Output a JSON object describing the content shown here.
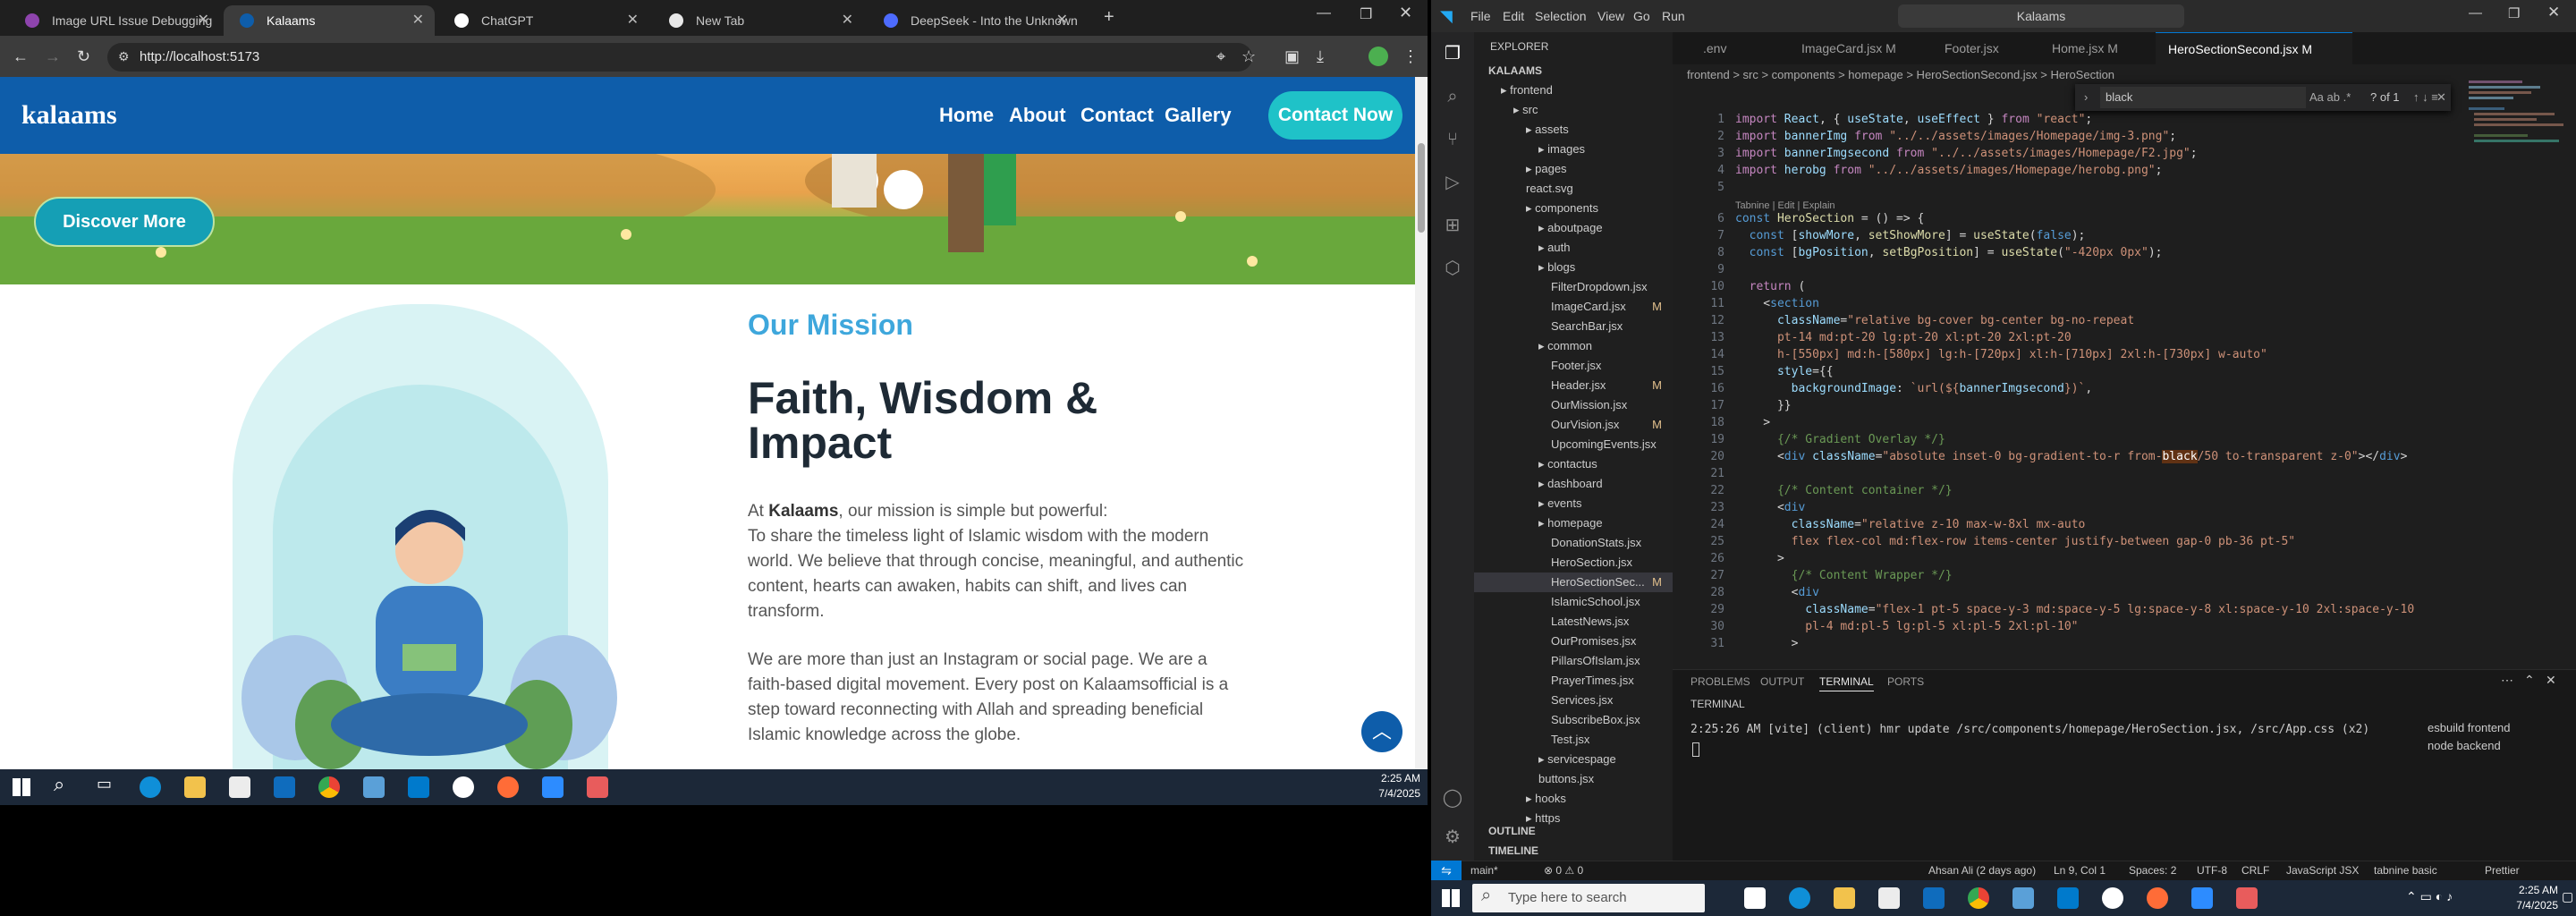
{
  "chrome": {
    "tabs": [
      {
        "label": "Image URL Issue Debugging",
        "fav": "#8e44ad"
      },
      {
        "label": "Kalaams",
        "fav": "#0e5daa"
      },
      {
        "label": "ChatGPT",
        "fav": "#ffffff"
      },
      {
        "label": "New Tab",
        "fav": "#e8e8e8"
      },
      {
        "label": "DeepSeek - Into the Unknown",
        "fav": "#4d6bfe"
      }
    ],
    "url": "http://localhost:5173"
  },
  "site": {
    "logo": "kalaams",
    "nav": [
      "Home",
      "About",
      "Contact",
      "Gallery"
    ],
    "contact_btn": "Contact Now",
    "discover_btn": "Discover More",
    "mission_label": "Our Mission",
    "mission_title": "Faith, Wisdom & Impact",
    "p1_prefix": "At ",
    "p1_brand": "Kalaams",
    "p1_suffix": ", our mission is simple but powerful:",
    "p2": "To share the timeless light of Islamic wisdom with the modern world. We believe that through concise, meaningful, and authentic content, hearts can awaken, habits can shift, and lives can transform.",
    "p3": "We are more than just an Instagram or social page. We are a faith-based digital movement. Every post on Kalaamsofficial is a step toward reconnecting with Allah and spreading beneficial Islamic knowledge across the globe."
  },
  "taskbar_left": {
    "time": "2:25 AM",
    "date": "7/4/2025"
  },
  "vscode": {
    "menu": [
      "File",
      "Edit",
      "Selection",
      "View",
      "Go",
      "Run"
    ],
    "search": "Kalaams",
    "explorer_title": "EXPLORER",
    "tree": [
      {
        "label": "KALAAMS",
        "indent": 0,
        "bold": true
      },
      {
        "label": "frontend",
        "indent": 1,
        "folder": true
      },
      {
        "label": "src",
        "indent": 2,
        "folder": true
      },
      {
        "label": "assets",
        "indent": 3,
        "folder": true
      },
      {
        "label": "images",
        "indent": 4,
        "folder": true
      },
      {
        "label": "pages",
        "indent": 3,
        "folder": true
      },
      {
        "label": "react.svg",
        "indent": 3
      },
      {
        "label": "components",
        "indent": 3,
        "folder": true
      },
      {
        "label": "aboutpage",
        "indent": 4,
        "folder": true
      },
      {
        "label": "auth",
        "indent": 4,
        "folder": true
      },
      {
        "label": "blogs",
        "indent": 4,
        "folder": true
      },
      {
        "label": "FilterDropdown.jsx",
        "indent": 5
      },
      {
        "label": "ImageCard.jsx",
        "indent": 5,
        "badge": "M"
      },
      {
        "label": "SearchBar.jsx",
        "indent": 5
      },
      {
        "label": "common",
        "indent": 4,
        "folder": true
      },
      {
        "label": "Footer.jsx",
        "indent": 5
      },
      {
        "label": "Header.jsx",
        "indent": 5,
        "badge": "M"
      },
      {
        "label": "OurMission.jsx",
        "indent": 5
      },
      {
        "label": "OurVision.jsx",
        "indent": 5,
        "badge": "M"
      },
      {
        "label": "UpcomingEvents.jsx",
        "indent": 5
      },
      {
        "label": "contactus",
        "indent": 4,
        "folder": true
      },
      {
        "label": "dashboard",
        "indent": 4,
        "folder": true
      },
      {
        "label": "events",
        "indent": 4,
        "folder": true
      },
      {
        "label": "homepage",
        "indent": 4,
        "folder": true
      },
      {
        "label": "DonationStats.jsx",
        "indent": 5
      },
      {
        "label": "HeroSection.jsx",
        "indent": 5
      },
      {
        "label": "HeroSectionSec...",
        "indent": 5,
        "badge": "M",
        "selected": true
      },
      {
        "label": "IslamicSchool.jsx",
        "indent": 5
      },
      {
        "label": "LatestNews.jsx",
        "indent": 5
      },
      {
        "label": "OurPromises.jsx",
        "indent": 5
      },
      {
        "label": "PillarsOfIslam.jsx",
        "indent": 5
      },
      {
        "label": "PrayerTimes.jsx",
        "indent": 5
      },
      {
        "label": "Services.jsx",
        "indent": 5
      },
      {
        "label": "SubscribeBox.jsx",
        "indent": 5
      },
      {
        "label": "Test.jsx",
        "indent": 5
      },
      {
        "label": "servicespage",
        "indent": 4,
        "folder": true
      },
      {
        "label": "buttons.jsx",
        "indent": 4
      },
      {
        "label": "hooks",
        "indent": 3,
        "folder": true
      },
      {
        "label": "https",
        "indent": 3,
        "folder": true
      }
    ],
    "outline": "OUTLINE",
    "timeline": "TIMELINE",
    "tabs": [
      {
        "label": ".env",
        "active": false
      },
      {
        "label": "ImageCard.jsx M",
        "active": false
      },
      {
        "label": "Footer.jsx",
        "active": false
      },
      {
        "label": "Home.jsx M",
        "active": false
      },
      {
        "label": "HeroSectionSecond.jsx M",
        "active": true
      }
    ],
    "breadcrumb": "frontend > src > components > homepage > HeroSectionSecond.jsx > HeroSection",
    "find_value": "black",
    "find_count": "? of 1",
    "codelens": "Tabnine | Edit | Explain",
    "panel_tabs": [
      "PROBLEMS",
      "OUTPUT",
      "TERMINAL",
      "PORTS"
    ],
    "terminal_label": "TERMINAL",
    "terminal_line": "2:25:26 AM [vite] (client) hmr update /src/components/homepage/HeroSection.jsx, /src/App.css (x2)",
    "terminals": [
      "esbuild frontend",
      "node backend"
    ],
    "status": {
      "branch": "main*",
      "problems": "⊗ 0 ⚠ 0",
      "author": "Ahsan Ali (2 days ago)",
      "position": "Ln 9, Col 1",
      "spaces": "Spaces: 2",
      "encoding": "UTF-8",
      "eol": "CRLF",
      "lang": "JavaScript JSX",
      "tabnine": "tabnine basic",
      "prettier": "Prettier"
    }
  },
  "taskbar_right": {
    "search_placeholder": "Type here to search",
    "time": "2:25 AM",
    "date": "7/4/2025"
  }
}
